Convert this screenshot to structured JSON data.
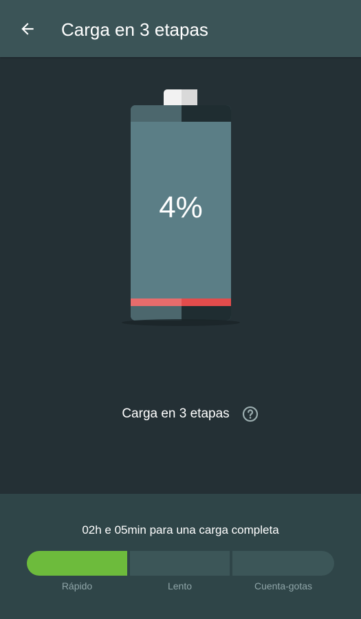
{
  "header": {
    "title": "Carga en 3 etapas",
    "back_icon": "arrow-left-icon"
  },
  "battery": {
    "percent_label": "4%",
    "level": 0.04,
    "colors": {
      "body": "#5b7e86",
      "cap": "#f2f2f2",
      "low_level": "#e85a5a"
    }
  },
  "stage_section": {
    "label": "Carga en 3 etapas",
    "help_icon": "help-circle-icon"
  },
  "bottom": {
    "time_text": "02h e 05min para una carga completa",
    "active_stage": 0,
    "stages": [
      "Rápido",
      "Lento",
      "Cuenta-gotas"
    ],
    "colors": {
      "active": "#6dbb3c",
      "inactive": "#3c5658"
    }
  }
}
